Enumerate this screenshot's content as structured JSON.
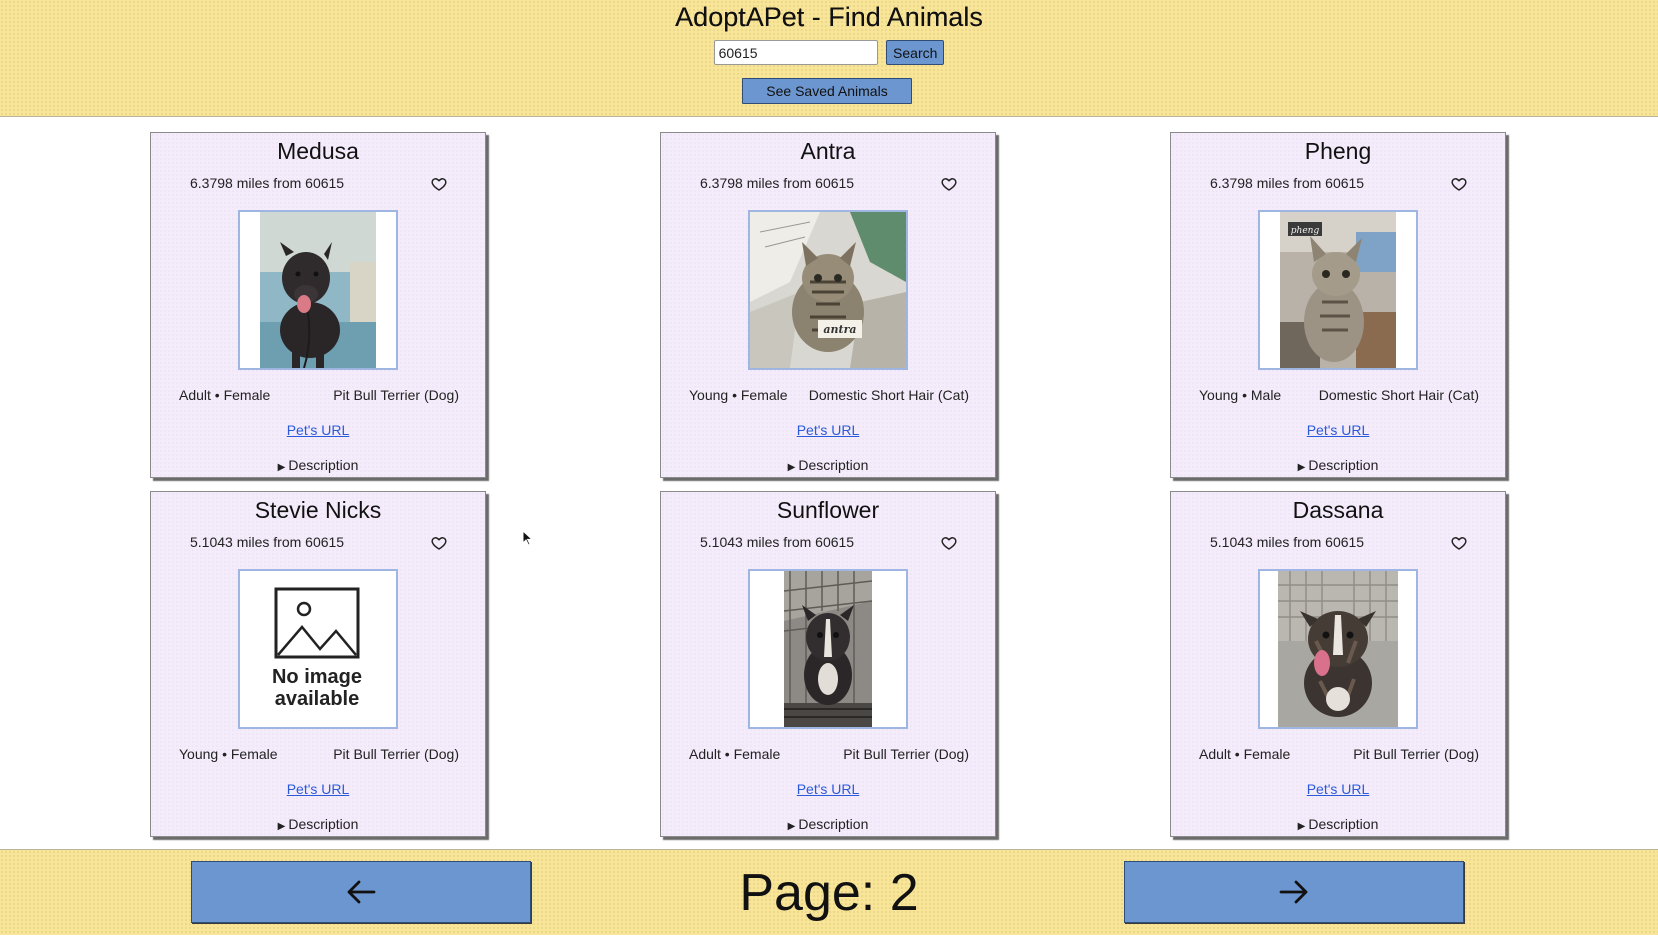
{
  "app": {
    "title": "AdoptAPet - Find Animals"
  },
  "search": {
    "value": "60615",
    "button_label": "Search"
  },
  "saved_button_label": "See Saved Animals",
  "colors": {
    "header_bg": "#f9e597",
    "card_bg": "#f4ecfb",
    "button_bg": "#6c96cf",
    "link": "#2a5ad9",
    "photo_border": "#9fb6e3"
  },
  "cards": [
    {
      "name": "Medusa",
      "distance": "6.3798 miles from 60615",
      "age_sex": "Adult • Female",
      "breed": "Pit Bull Terrier (Dog)",
      "link_label": "Pet's URL",
      "description_label": "Description",
      "photo": "dark-brindle-dog-photo"
    },
    {
      "name": "Antra",
      "distance": "6.3798 miles from 60615",
      "age_sex": "Young • Female",
      "breed": "Domestic Short Hair (Cat)",
      "link_label": "Pet's URL",
      "description_label": "Description",
      "photo": "tabby-cat-photo",
      "photo_caption": "antra"
    },
    {
      "name": "Pheng",
      "distance": "6.3798 miles from 60615",
      "age_sex": "Young • Male",
      "breed": "Domestic Short Hair (Cat)",
      "link_label": "Pet's URL",
      "description_label": "Description",
      "photo": "tabby-cat-photo",
      "photo_caption": "pheng"
    },
    {
      "name": "Stevie Nicks",
      "distance": "5.1043 miles from 60615",
      "age_sex": "Young • Female",
      "breed": "Pit Bull Terrier (Dog)",
      "link_label": "Pet's URL",
      "description_label": "Description",
      "photo": "no-image-placeholder",
      "no_image_text": "No image available"
    },
    {
      "name": "Sunflower",
      "distance": "5.1043 miles from 60615",
      "age_sex": "Adult • Female",
      "breed": "Pit Bull Terrier (Dog)",
      "link_label": "Pet's URL",
      "description_label": "Description",
      "photo": "dark-dog-kennel-photo"
    },
    {
      "name": "Dassana",
      "distance": "5.1043 miles from 60615",
      "age_sex": "Adult • Female",
      "breed": "Pit Bull Terrier (Dog)",
      "link_label": "Pet's URL",
      "description_label": "Description",
      "photo": "brindle-dog-photo"
    }
  ],
  "pagination": {
    "page_label": "Page: 2",
    "prev_icon": "arrow-left-icon",
    "next_icon": "arrow-right-icon"
  }
}
